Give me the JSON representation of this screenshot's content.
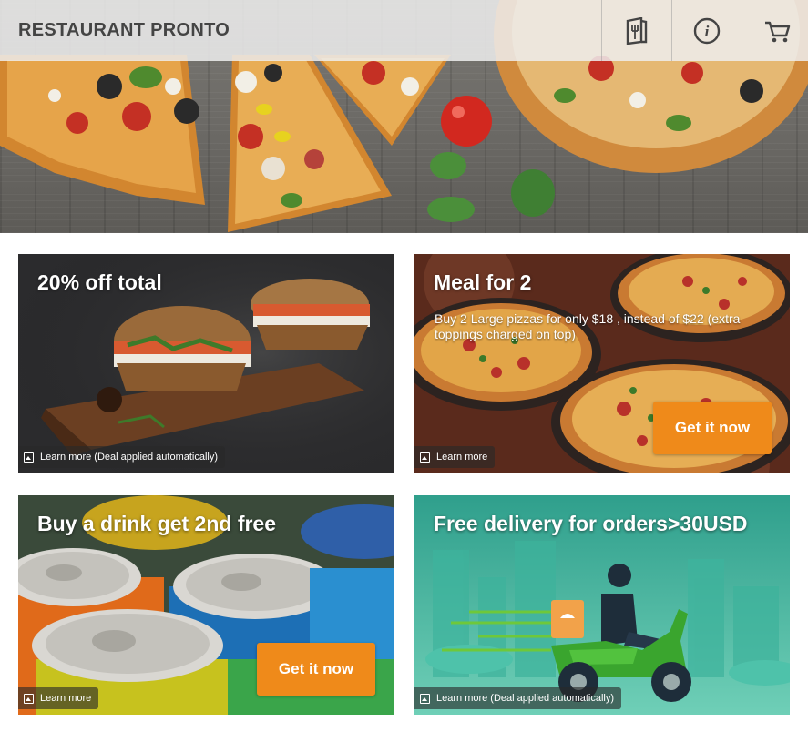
{
  "header": {
    "brand": "RESTAURANT PRONTO",
    "nav": [
      {
        "icon": "menu-book-icon"
      },
      {
        "icon": "info-icon"
      },
      {
        "icon": "cart-icon"
      }
    ]
  },
  "deals": [
    {
      "title": "20% off total",
      "description": "",
      "learn_more": "Learn more (Deal applied automatically)",
      "button": ""
    },
    {
      "title": "Meal for 2",
      "description": "Buy 2 Large pizzas for only $18 , instead of $22 (extra toppings charged on top)",
      "learn_more": "Learn more",
      "button": "Get it now"
    },
    {
      "title": "Buy a drink get 2nd free",
      "description": "",
      "learn_more": "Learn more",
      "button": "Get it now"
    },
    {
      "title": "Free delivery for orders>30USD",
      "description": "",
      "learn_more": "Learn more (Deal applied automatically)",
      "button": ""
    }
  ],
  "colors": {
    "accent": "#ef8a1a",
    "header_bg": "#eeeeee",
    "brand_text": "#444444"
  }
}
